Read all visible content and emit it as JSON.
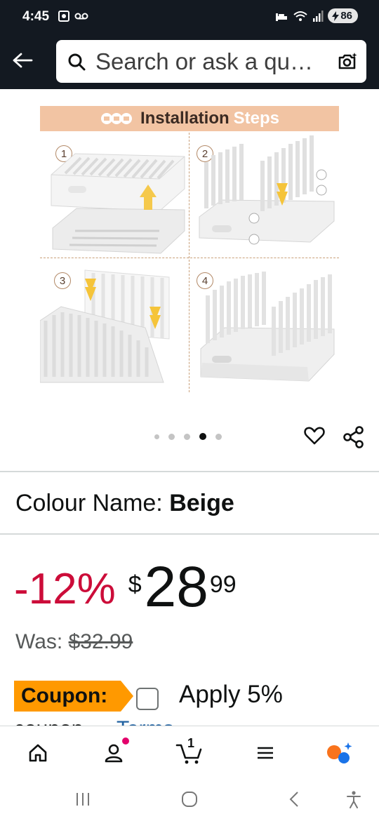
{
  "status_bar": {
    "time": "4:45",
    "battery": "86"
  },
  "header": {
    "search_placeholder": "Search or ask a qu…"
  },
  "gallery": {
    "banner_word1": "Installation",
    "banner_word2": "Steps",
    "step_numbers": [
      "1",
      "2",
      "3",
      "4"
    ],
    "dot_count": 5,
    "active_dot_index": 3
  },
  "product": {
    "colour_label": "Colour Name: ",
    "colour_value": "Beige",
    "discount": "-12%",
    "currency": "$",
    "price_whole": "28",
    "price_fraction": "99",
    "was_label": "Was: ",
    "was_price": "$32.99",
    "coupon_badge": "Coupon:",
    "coupon_text": "Apply 5%",
    "coupon_cut_text": "coupon",
    "coupon_terms": "Terms"
  },
  "bottom_nav": {
    "cart_count": "1"
  },
  "colors": {
    "header_bg": "#131921",
    "deal_red": "#cc0c39",
    "coupon_orange": "#ff9900",
    "banner_peach": "#f2c4a3",
    "link_blue": "#2162a1"
  }
}
